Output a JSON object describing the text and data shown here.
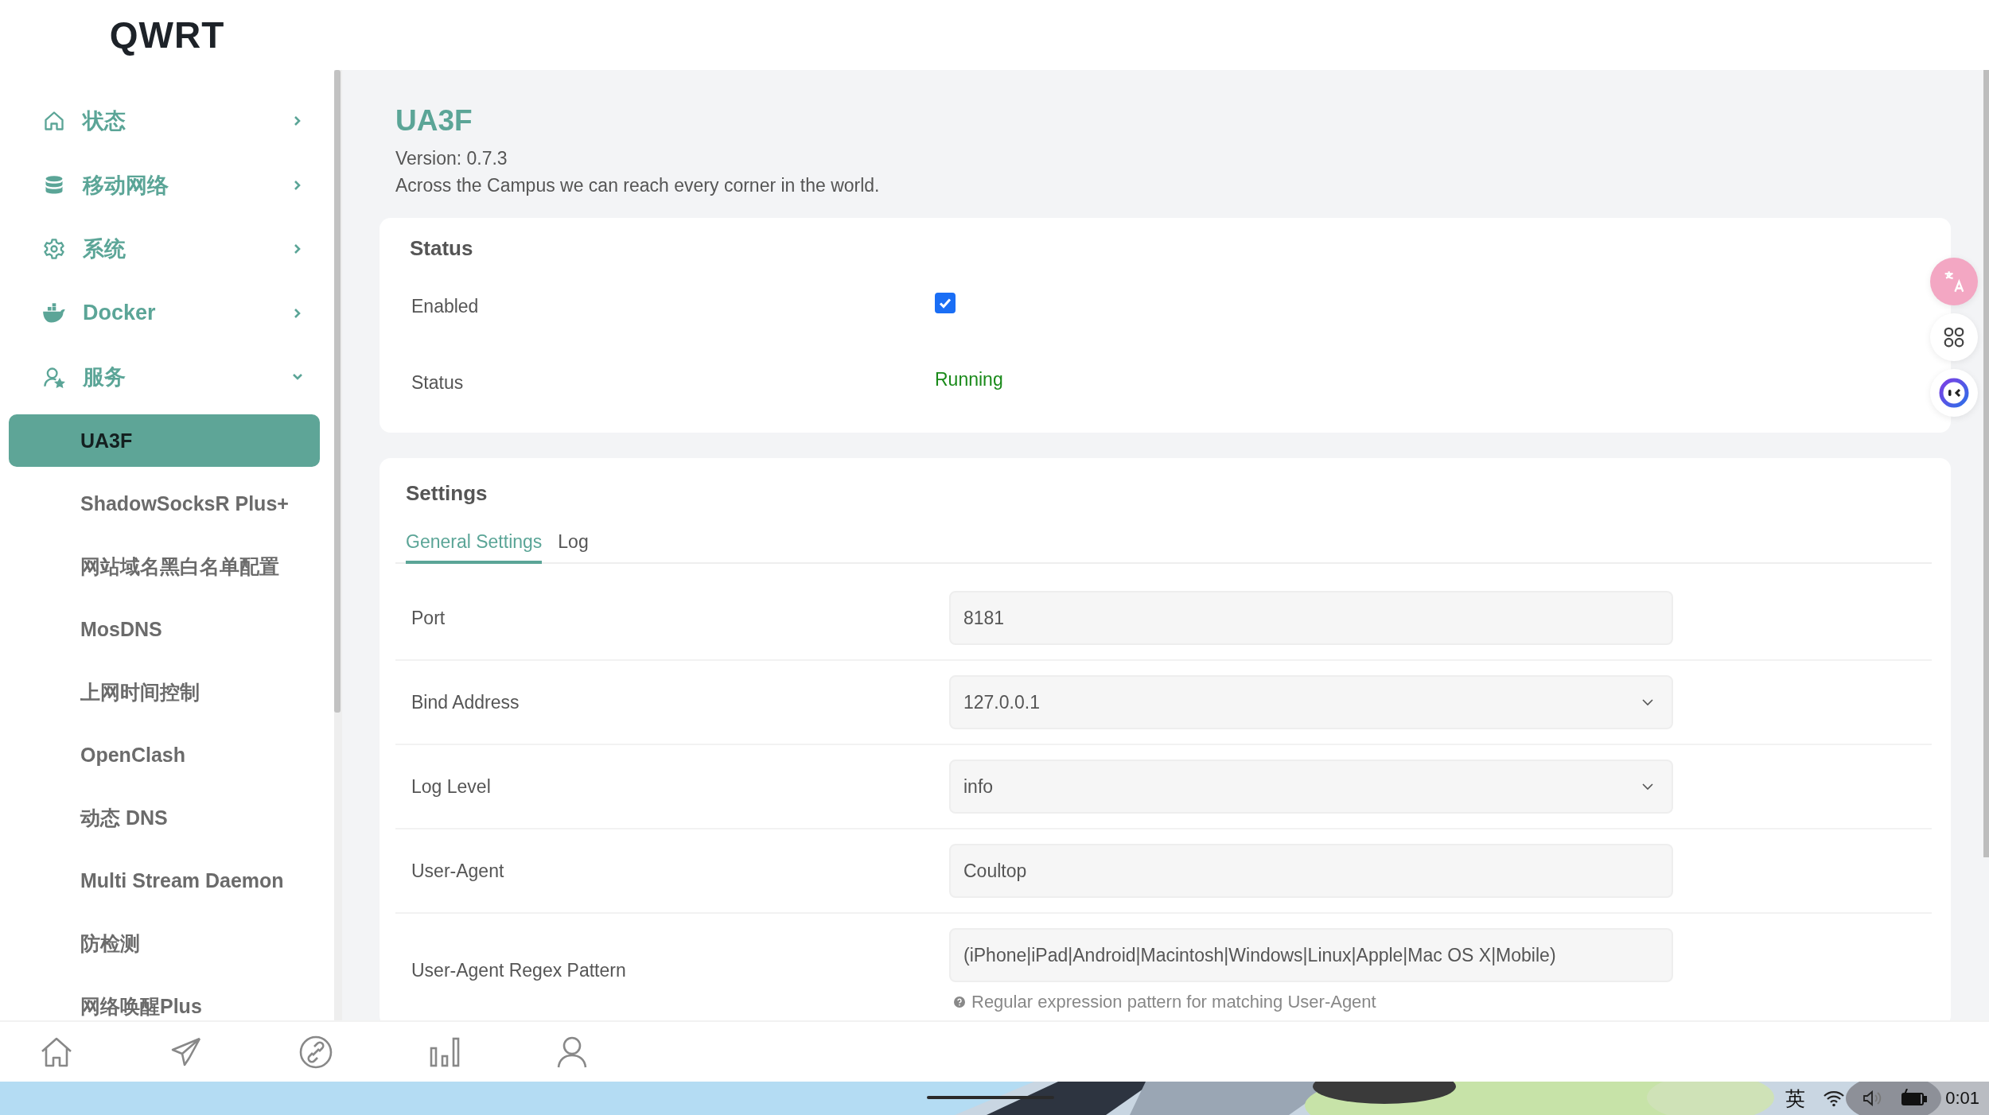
{
  "logo": "QWRT",
  "sidebar": {
    "items": [
      {
        "label": "状态",
        "expanded": false
      },
      {
        "label": "移动网络",
        "expanded": false
      },
      {
        "label": "系统",
        "expanded": false
      },
      {
        "label": "Docker",
        "expanded": false
      },
      {
        "label": "服务",
        "expanded": true,
        "children": [
          {
            "label": "UA3F",
            "selected": true
          },
          {
            "label": "ShadowSocksR Plus+",
            "selected": false
          },
          {
            "label": "网站域名黑白名单配置",
            "selected": false
          },
          {
            "label": "MosDNS",
            "selected": false
          },
          {
            "label": "上网时间控制",
            "selected": false
          },
          {
            "label": "OpenClash",
            "selected": false
          },
          {
            "label": "动态 DNS",
            "selected": false
          },
          {
            "label": "Multi Stream Daemon",
            "selected": false
          },
          {
            "label": "防检测",
            "selected": false
          },
          {
            "label": "网络唤醒Plus",
            "selected": false
          }
        ]
      }
    ]
  },
  "page": {
    "title": "UA3F",
    "version": "Version: 0.7.3",
    "description": "Across the Campus we can reach every corner in the world."
  },
  "status": {
    "title": "Status",
    "rows": [
      {
        "label": "Enabled",
        "kind": "checkbox",
        "checked": true
      },
      {
        "label": "Status",
        "kind": "state",
        "value": "Running"
      }
    ]
  },
  "settings": {
    "title": "Settings",
    "tabs": [
      {
        "label": "General Settings",
        "selected": true
      },
      {
        "label": "Log",
        "selected": false
      }
    ],
    "fields": [
      {
        "label": "Port",
        "kind": "text",
        "value": "8181"
      },
      {
        "label": "Bind Address",
        "kind": "select",
        "value": "127.0.0.1"
      },
      {
        "label": "Log Level",
        "kind": "select",
        "value": "info"
      },
      {
        "label": "User-Agent",
        "kind": "text",
        "value": "Coultop"
      },
      {
        "label": "User-Agent Regex Pattern",
        "kind": "text",
        "value": "(iPhone|iPad|Android|Macintosh|Windows|Linux|Apple|Mac OS X|Mobile)",
        "help": "Regular expression pattern for matching User-Agent"
      }
    ]
  },
  "taskbar": {
    "input_method": "英",
    "time": "0:01"
  }
}
